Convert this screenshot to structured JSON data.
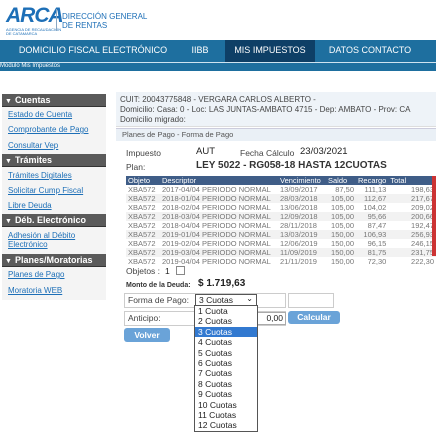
{
  "header": {
    "logo": "ARCA",
    "logo_sub": "AGENCIA DE RECAUDACIÓN DE CATAMARCA",
    "direction_line1": "DIRECCIÓN GENERAL",
    "direction_line2": "DE RENTAS"
  },
  "nav": {
    "items": [
      {
        "label": "DOMICILIO FISCAL ELECTRÓNICO"
      },
      {
        "label": "IIBB"
      },
      {
        "label": "MIS IMPUESTOS"
      },
      {
        "label": "DATOS CONTACTO"
      }
    ],
    "breadcrumb": "Modulo Mis Impuestos"
  },
  "sidebar": {
    "sections": [
      {
        "title": "Cuentas",
        "items": [
          "Estado de Cuenta",
          "Comprobante de Pago",
          "Consultar Vep"
        ]
      },
      {
        "title": "Trámites",
        "items": [
          "Trámites Digitales",
          "Solicitar Cump Fiscal",
          "Libre Deuda"
        ]
      },
      {
        "title": "Déb. Electrónico",
        "items": [
          "Adhesión al Débito",
          "Electrónico"
        ]
      },
      {
        "title": "Planes/Moratorias",
        "items": [
          "Planes de Pago",
          "Moratoria WEB"
        ]
      }
    ]
  },
  "taxpayer": {
    "line1": "CUIT: 20043775848 - VERGARA CARLOS ALBERTO -",
    "line2": "Domicilio: Casa: 0 - Loc: LAS JUNTAS-AMBATO 4715 - Dep: AMBATO - Prov: CA",
    "line3": "Domicilio migrado:"
  },
  "form": {
    "title": "Planes de Pago - Forma de Pago",
    "impuesto_label": "Impuesto",
    "impuesto_value": "AUT",
    "fecha_label": "Fecha Cálculo",
    "fecha_value": "23/03/2021",
    "plan_label": "Plan:",
    "plan_value": "LEY 5022 - RG058-18 HASTA 12CUOTAS",
    "objetos_label": "Objetos :",
    "objetos_count": "1",
    "monto_label": "Monto de la Deuda:",
    "monto_value": "$ 1.719,63",
    "forma_pago_label": "Forma de Pago:",
    "forma_pago_selected": "3 Cuotas",
    "anticipo_label": "Anticipo:",
    "anticipo_value": "0,00",
    "calcular_label": "Calcular",
    "volver_label": "Volver",
    "options": [
      "1 Cuota",
      "2 Cuotas",
      "3 Cuotas",
      "4 Cuotas",
      "5 Cuotas",
      "6 Cuotas",
      "7 Cuotas",
      "8 Cuotas",
      "9 Cuotas",
      "10 Cuotas",
      "11 Cuotas",
      "12 Cuotas"
    ]
  },
  "table": {
    "headers": [
      "Objeto",
      "Descriptor",
      "Vencimiento",
      "Saldo",
      "Recargo",
      "Total"
    ],
    "rows": [
      [
        "XBA572",
        "2017-04/04 PERIODO NORMAL",
        "13/09/2017",
        "87,50",
        "111,13",
        "198,63"
      ],
      [
        "XBA572",
        "2018-01/04 PERIODO NORMAL",
        "28/03/2018",
        "105,00",
        "112,67",
        "217,67"
      ],
      [
        "XBA572",
        "2018-02/04 PERIODO NORMAL",
        "13/06/2018",
        "105,00",
        "104,02",
        "209,02"
      ],
      [
        "XBA572",
        "2018-03/04 PERIODO NORMAL",
        "12/09/2018",
        "105,00",
        "95,66",
        "200,66"
      ],
      [
        "XBA572",
        "2018-04/04 PERIODO NORMAL",
        "28/11/2018",
        "105,00",
        "87,47",
        "192,47"
      ],
      [
        "XBA572",
        "2019-01/04 PERIODO NORMAL",
        "13/03/2019",
        "150,00",
        "106,93",
        "256,93"
      ],
      [
        "XBA572",
        "2019-02/04 PERIODO NORMAL",
        "12/06/2019",
        "150,00",
        "96,15",
        "246,15"
      ],
      [
        "XBA572",
        "2019-03/04 PERIODO NORMAL",
        "11/09/2019",
        "150,00",
        "81,75",
        "231,75"
      ],
      [
        "XBA572",
        "2019-04/04 PERIODO NORMAL",
        "21/11/2019",
        "150,00",
        "72,30",
        "222,30"
      ]
    ]
  }
}
